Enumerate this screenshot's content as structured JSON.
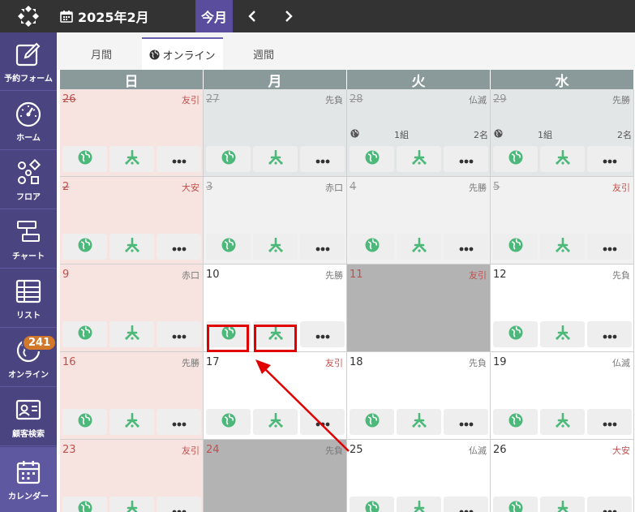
{
  "header": {
    "month": "2025年2月",
    "today_label": "今月",
    "prev_icon": "chevron-left-icon",
    "next_icon": "chevron-right-icon"
  },
  "sidebar": {
    "items": [
      {
        "label": "予約フォーム",
        "icon": "edit-icon"
      },
      {
        "label": "ホーム",
        "icon": "gauge-icon"
      },
      {
        "label": "フロア",
        "icon": "floor-icon"
      },
      {
        "label": "チャート",
        "icon": "chart-icon"
      },
      {
        "label": "リスト",
        "icon": "table-icon"
      },
      {
        "label": "オンライン",
        "icon": "globe-icon",
        "badge": "241"
      },
      {
        "label": "顧客検索",
        "icon": "id-card-icon"
      },
      {
        "label": "カレンダー",
        "icon": "calendar-icon",
        "active": true
      }
    ]
  },
  "tabs": [
    {
      "label": "月間",
      "active": false
    },
    {
      "label": "オンライン",
      "active": true
    },
    {
      "label": "週間",
      "active": false
    }
  ],
  "calendar": {
    "weekdays": [
      "日",
      "月",
      "火",
      "水"
    ],
    "weeks": [
      [
        {
          "day": "26",
          "rokuyo": "友引",
          "past": true
        },
        {
          "day": "27",
          "rokuyo": "先負",
          "past": true
        },
        {
          "day": "28",
          "rokuyo": "仏滅",
          "past": true,
          "groups": "1組",
          "people": "2名"
        },
        {
          "day": "29",
          "rokuyo": "先勝",
          "past": true,
          "groups": "1組",
          "people": "2名"
        }
      ],
      [
        {
          "day": "2",
          "rokuyo": "大安",
          "past": true
        },
        {
          "day": "3",
          "rokuyo": "赤口",
          "past": true
        },
        {
          "day": "4",
          "rokuyo": "先勝",
          "past": true
        },
        {
          "day": "5",
          "rokuyo": "友引",
          "past": true
        }
      ],
      [
        {
          "day": "9",
          "rokuyo": "赤口"
        },
        {
          "day": "10",
          "rokuyo": "先勝"
        },
        {
          "day": "11",
          "rokuyo": "友引",
          "closed": true
        },
        {
          "day": "12",
          "rokuyo": "先負"
        }
      ],
      [
        {
          "day": "16",
          "rokuyo": "先勝"
        },
        {
          "day": "17",
          "rokuyo": "友引"
        },
        {
          "day": "18",
          "rokuyo": "先負"
        },
        {
          "day": "19",
          "rokuyo": "仏滅"
        }
      ],
      [
        {
          "day": "23",
          "rokuyo": "友引"
        },
        {
          "day": "24",
          "rokuyo": "先負",
          "closed": true
        },
        {
          "day": "25",
          "rokuyo": "仏滅"
        },
        {
          "day": "26",
          "rokuyo": "大安"
        }
      ]
    ],
    "cell_buttons": [
      "globe-icon",
      "seat-icon",
      "more-icon"
    ]
  },
  "colors": {
    "topbar": "#333333",
    "sidebar": "#4a4480",
    "accent": "#5b4d9e",
    "icon_green": "#4cb87a",
    "sunday_bg": "#f7e3e0",
    "past_bg": "#e2e6e6",
    "closed_bg": "#b3b3b3",
    "highlight": "#e00000"
  }
}
